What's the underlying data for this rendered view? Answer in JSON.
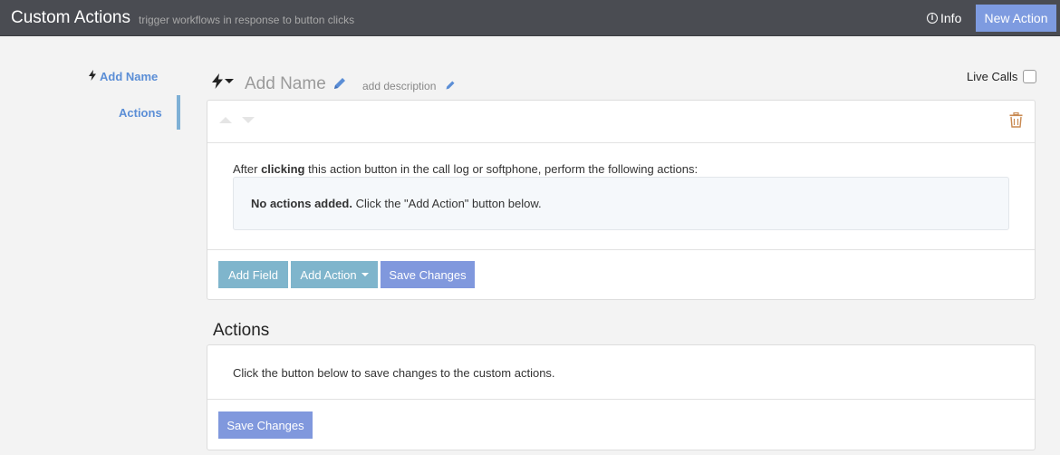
{
  "header": {
    "title": "Custom Actions",
    "subtitle": "trigger workflows in response to button clicks",
    "info_label": "Info",
    "new_action_label": "New Action"
  },
  "sidebar": {
    "items": [
      {
        "label": "Add Name",
        "icon": "bolt-icon"
      },
      {
        "label": "Actions"
      }
    ]
  },
  "action": {
    "name": "Add Name",
    "description": "add description",
    "live_calls_label": "Live Calls",
    "live_calls_checked": false,
    "instruction_prefix": "After ",
    "instruction_bold": "clicking",
    "instruction_suffix": " this action button in the call log or softphone, perform the following actions:",
    "empty_bold": "No actions added.",
    "empty_text": " Click the \"Add Action\" button below.",
    "buttons": {
      "add_field": "Add Field",
      "add_action": "Add Action",
      "save_changes": "Save Changes"
    }
  },
  "actions_section": {
    "title": "Actions",
    "text": "Click the button below to save changes to the custom actions.",
    "save_label": "Save Changes"
  },
  "colors": {
    "topbar": "#4a4c52",
    "accent_blue": "#8098dd",
    "accent_teal": "#7fb5cc",
    "link": "#5b8ed6",
    "trash": "#c98a52"
  }
}
